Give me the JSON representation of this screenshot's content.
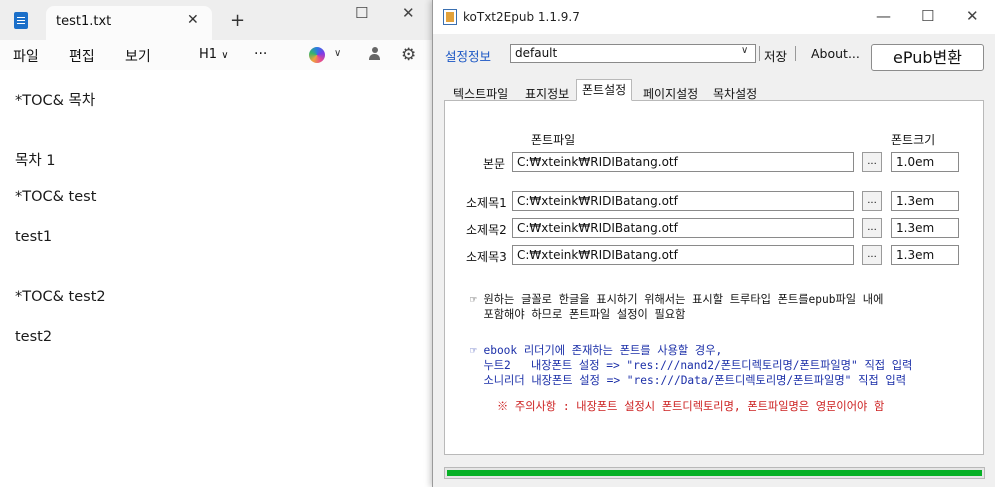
{
  "notepad": {
    "tab_title": "test1.txt",
    "tab_close": "✕",
    "new_tab": "+",
    "menu": [
      "파일",
      "편집",
      "보기"
    ],
    "heading_dropdown": "H1",
    "more_label": "···",
    "lines": [
      "*TOC& 목차",
      "목차 1",
      "*TOC& test",
      "test1",
      "*TOC& test2",
      "test2"
    ]
  },
  "app": {
    "title": "koTxt2Epub 1.1.9.7",
    "settings_label": "설정정보",
    "preset_value": "default",
    "save_label": "저장",
    "about_label": "About...",
    "convert_label": "ePub변환",
    "tabs": [
      "텍스트파일",
      "표지정보",
      "폰트설정",
      "페이지설정",
      "목차설정"
    ],
    "active_tab": 2,
    "font_tab": {
      "file_header": "폰트파일",
      "size_header": "폰트크기",
      "browse_label": "...",
      "rows": [
        {
          "label": "본문",
          "path": "C:₩xteink₩RIDIBatang.otf",
          "size": "1.0em"
        },
        {
          "label": "소제목1",
          "path": "C:₩xteink₩RIDIBatang.otf",
          "size": "1.3em"
        },
        {
          "label": "소제목2",
          "path": "C:₩xteink₩RIDIBatang.otf",
          "size": "1.3em"
        },
        {
          "label": "소제목3",
          "path": "C:₩xteink₩RIDIBatang.otf",
          "size": "1.3em"
        }
      ],
      "note1": "☞ 원하는 글꼴로 한글을 표시하기 위해서는 표시할 트루타입 폰트를epub파일 내에",
      "note2": "  포함해야 하므로 폰트파일 설정이 필요함",
      "note3": "☞ ebook 리더기에 존재하는 폰트를 사용할 경우,",
      "note4": "  누트2   내장폰트 설정 => \"res:///nand2/폰트디렉토리명/폰트파일명\" 직접 입력",
      "note5": "  소니리더 내장폰트 설정 => \"res:///Data/폰트디렉토리명/폰트파일명\" 직접 입력",
      "warning": "※ 주의사항 : 내장폰트 설정시 폰트디렉토리명, 폰트파일명은 영문이어야 함"
    },
    "progress": 1.0,
    "progress_color": "#06b025"
  }
}
